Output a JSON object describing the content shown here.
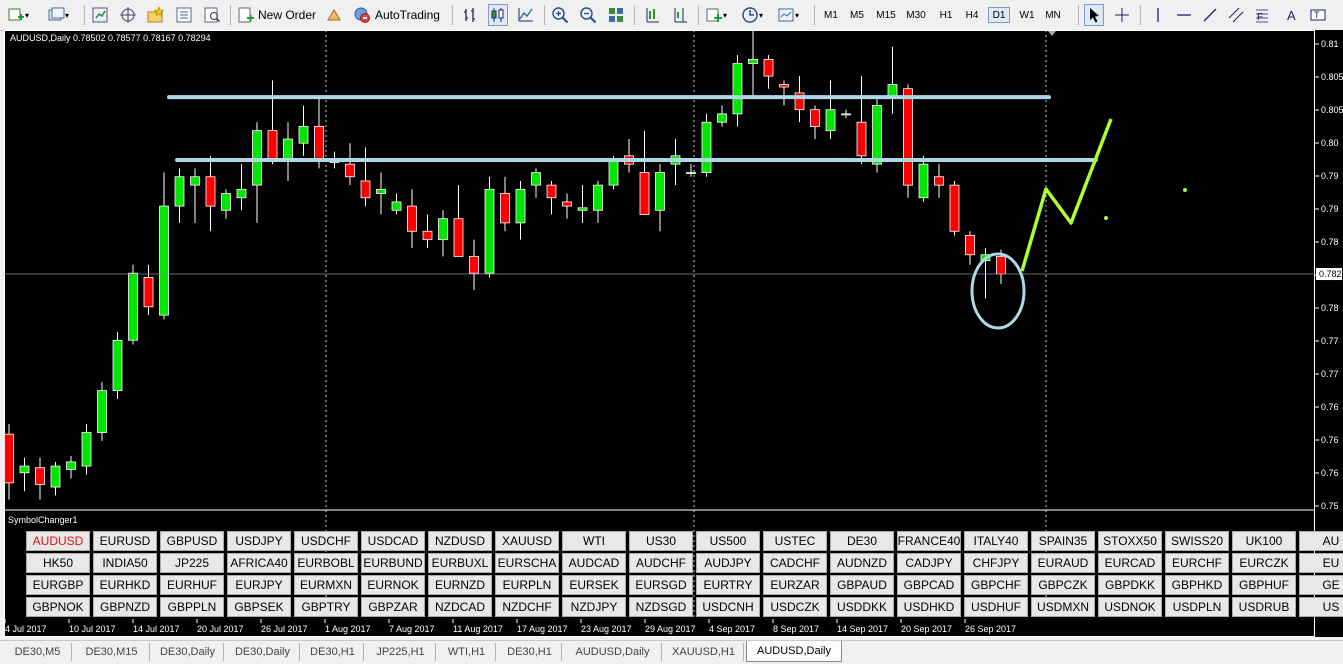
{
  "toolbar": {
    "new_order_label": "New Order",
    "autotrading_label": "AutoTrading",
    "timeframes": [
      "M1",
      "M5",
      "M15",
      "M30",
      "H1",
      "H4",
      "D1",
      "W1",
      "MN"
    ],
    "active_timeframe": "D1"
  },
  "chart": {
    "info_text": "AUDUSD,Daily  0.78502 0.78577 0.78167 0.78294",
    "symbol_changer_label": "SymbolChanger1",
    "price_axis_labels": [
      "0.81",
      "0.805",
      "0.805",
      "0.80",
      "0.79",
      "0.79",
      "0.78",
      "0.78",
      "0.78",
      "0.77",
      "0.77",
      "0.76",
      "0.76",
      "0.76",
      "0.75"
    ],
    "current_price_label": "0.782",
    "date_axis_labels": [
      "4 Jul 2017",
      "10 Jul 2017",
      "14 Jul 2017",
      "20 Jul 2017",
      "26 Jul 2017",
      "1 Aug 2017",
      "7 Aug 2017",
      "11 Aug 2017",
      "17 Aug 2017",
      "23 Aug 2017",
      "29 Aug 2017",
      "4 Sep 2017",
      "8 Sep 2017",
      "14 Sep 2017",
      "20 Sep 2017",
      "26 Sep 2017"
    ]
  },
  "chart_data": {
    "type": "candlestick",
    "symbol": "AUDUSD",
    "timeframe": "Daily",
    "ylim": [
      0.755,
      0.812
    ],
    "candles": [
      {
        "o": 0.7638,
        "h": 0.765,
        "l": 0.756,
        "c": 0.758
      },
      {
        "o": 0.7592,
        "h": 0.761,
        "l": 0.757,
        "c": 0.76
      },
      {
        "o": 0.7598,
        "h": 0.761,
        "l": 0.756,
        "c": 0.7578
      },
      {
        "o": 0.7575,
        "h": 0.7605,
        "l": 0.7565,
        "c": 0.76
      },
      {
        "o": 0.7596,
        "h": 0.7612,
        "l": 0.7585,
        "c": 0.7605
      },
      {
        "o": 0.76,
        "h": 0.765,
        "l": 0.759,
        "c": 0.764
      },
      {
        "o": 0.764,
        "h": 0.77,
        "l": 0.763,
        "c": 0.769
      },
      {
        "o": 0.769,
        "h": 0.776,
        "l": 0.768,
        "c": 0.775
      },
      {
        "o": 0.775,
        "h": 0.784,
        "l": 0.7745,
        "c": 0.783
      },
      {
        "o": 0.7825,
        "h": 0.784,
        "l": 0.778,
        "c": 0.779
      },
      {
        "o": 0.778,
        "h": 0.795,
        "l": 0.7775,
        "c": 0.791
      },
      {
        "o": 0.791,
        "h": 0.7955,
        "l": 0.789,
        "c": 0.7945
      },
      {
        "o": 0.7935,
        "h": 0.7955,
        "l": 0.789,
        "c": 0.7945
      },
      {
        "o": 0.7945,
        "h": 0.797,
        "l": 0.788,
        "c": 0.791
      },
      {
        "o": 0.7905,
        "h": 0.793,
        "l": 0.7895,
        "c": 0.7925
      },
      {
        "o": 0.792,
        "h": 0.796,
        "l": 0.7905,
        "c": 0.793
      },
      {
        "o": 0.7935,
        "h": 0.801,
        "l": 0.789,
        "c": 0.8
      },
      {
        "o": 0.8,
        "h": 0.806,
        "l": 0.796,
        "c": 0.7965
      },
      {
        "o": 0.7965,
        "h": 0.801,
        "l": 0.794,
        "c": 0.799
      },
      {
        "o": 0.7985,
        "h": 0.803,
        "l": 0.797,
        "c": 0.8005
      },
      {
        "o": 0.8005,
        "h": 0.804,
        "l": 0.7955,
        "c": 0.7965
      },
      {
        "o": 0.7962,
        "h": 0.7975,
        "l": 0.7955,
        "c": 0.7965
      },
      {
        "o": 0.796,
        "h": 0.7985,
        "l": 0.7935,
        "c": 0.7945
      },
      {
        "o": 0.794,
        "h": 0.798,
        "l": 0.791,
        "c": 0.792
      },
      {
        "o": 0.7925,
        "h": 0.795,
        "l": 0.79,
        "c": 0.793
      },
      {
        "o": 0.7905,
        "h": 0.7925,
        "l": 0.79,
        "c": 0.7915
      },
      {
        "o": 0.791,
        "h": 0.793,
        "l": 0.786,
        "c": 0.788
      },
      {
        "o": 0.788,
        "h": 0.79,
        "l": 0.786,
        "c": 0.787
      },
      {
        "o": 0.787,
        "h": 0.7905,
        "l": 0.785,
        "c": 0.7895
      },
      {
        "o": 0.7895,
        "h": 0.7935,
        "l": 0.785,
        "c": 0.785
      },
      {
        "o": 0.785,
        "h": 0.787,
        "l": 0.781,
        "c": 0.783
      },
      {
        "o": 0.783,
        "h": 0.7945,
        "l": 0.7825,
        "c": 0.793
      },
      {
        "o": 0.7925,
        "h": 0.7945,
        "l": 0.788,
        "c": 0.789
      },
      {
        "o": 0.789,
        "h": 0.794,
        "l": 0.787,
        "c": 0.793
      },
      {
        "o": 0.7935,
        "h": 0.7955,
        "l": 0.792,
        "c": 0.795
      },
      {
        "o": 0.7935,
        "h": 0.794,
        "l": 0.79,
        "c": 0.792
      },
      {
        "o": 0.7915,
        "h": 0.7925,
        "l": 0.7895,
        "c": 0.791
      },
      {
        "o": 0.7905,
        "h": 0.7935,
        "l": 0.789,
        "c": 0.7908
      },
      {
        "o": 0.7905,
        "h": 0.794,
        "l": 0.789,
        "c": 0.7935
      },
      {
        "o": 0.7935,
        "h": 0.797,
        "l": 0.793,
        "c": 0.7965
      },
      {
        "o": 0.797,
        "h": 0.799,
        "l": 0.795,
        "c": 0.796
      },
      {
        "o": 0.795,
        "h": 0.8,
        "l": 0.79,
        "c": 0.79
      },
      {
        "o": 0.7905,
        "h": 0.796,
        "l": 0.788,
        "c": 0.795
      },
      {
        "o": 0.796,
        "h": 0.799,
        "l": 0.7935,
        "c": 0.797
      },
      {
        "o": 0.795,
        "h": 0.796,
        "l": 0.7945,
        "c": 0.795
      },
      {
        "o": 0.795,
        "h": 0.802,
        "l": 0.7945,
        "c": 0.801
      },
      {
        "o": 0.801,
        "h": 0.803,
        "l": 0.8005,
        "c": 0.802
      },
      {
        "o": 0.802,
        "h": 0.809,
        "l": 0.8005,
        "c": 0.808
      },
      {
        "o": 0.808,
        "h": 0.812,
        "l": 0.804,
        "c": 0.8085
      },
      {
        "o": 0.8085,
        "h": 0.809,
        "l": 0.805,
        "c": 0.8065
      },
      {
        "o": 0.8055,
        "h": 0.806,
        "l": 0.803,
        "c": 0.8052
      },
      {
        "o": 0.8045,
        "h": 0.8065,
        "l": 0.801,
        "c": 0.8025
      },
      {
        "o": 0.8025,
        "h": 0.803,
        "l": 0.799,
        "c": 0.8005
      },
      {
        "o": 0.8,
        "h": 0.806,
        "l": 0.799,
        "c": 0.8025
      },
      {
        "o": 0.802,
        "h": 0.8025,
        "l": 0.8015,
        "c": 0.802
      },
      {
        "o": 0.801,
        "h": 0.8065,
        "l": 0.796,
        "c": 0.797
      },
      {
        "o": 0.796,
        "h": 0.804,
        "l": 0.795,
        "c": 0.803
      },
      {
        "o": 0.804,
        "h": 0.81,
        "l": 0.802,
        "c": 0.8055
      },
      {
        "o": 0.805,
        "h": 0.8055,
        "l": 0.792,
        "c": 0.7935
      },
      {
        "o": 0.792,
        "h": 0.797,
        "l": 0.7915,
        "c": 0.796
      },
      {
        "o": 0.7945,
        "h": 0.796,
        "l": 0.792,
        "c": 0.7935
      },
      {
        "o": 0.7935,
        "h": 0.794,
        "l": 0.7875,
        "c": 0.788
      },
      {
        "o": 0.7875,
        "h": 0.788,
        "l": 0.784,
        "c": 0.7852
      },
      {
        "o": 0.7845,
        "h": 0.786,
        "l": 0.78,
        "c": 0.7852
      },
      {
        "o": 0.785,
        "h": 0.7858,
        "l": 0.7817,
        "c": 0.7829
      }
    ],
    "horizontal_lines": [
      0.804,
      0.7965
    ],
    "current_price": 0.7829
  },
  "symbol_changer": {
    "active": "AUDUSD",
    "rows": [
      [
        "AUDUSD",
        "EURUSD",
        "GBPUSD",
        "USDJPY",
        "USDCHF",
        "USDCAD",
        "NZDUSD",
        "XAUUSD",
        "WTI",
        "US30",
        "US500",
        "USTEC",
        "DE30",
        "FRANCE40",
        "ITALY40",
        "SPAIN35",
        "STOXX50",
        "SWISS20",
        "UK100",
        "AU"
      ],
      [
        "HK50",
        "INDIA50",
        "JP225",
        "AFRICA40",
        "EURBOBL",
        "EURBUND",
        "EURBUXL",
        "EURSCHA",
        "AUDCAD",
        "AUDCHF",
        "AUDJPY",
        "CADCHF",
        "AUDNZD",
        "CADJPY",
        "CHFJPY",
        "EURAUD",
        "EURCAD",
        "EURCHF",
        "EURCZK",
        "EU"
      ],
      [
        "EURGBP",
        "EURHKD",
        "EURHUF",
        "EURJPY",
        "EURMXN",
        "EURNOK",
        "EURNZD",
        "EURPLN",
        "EURSEK",
        "EURSGD",
        "EURTRY",
        "EURZAR",
        "GBPAUD",
        "GBPCAD",
        "GBPCHF",
        "GBPCZK",
        "GBPDKK",
        "GBPHKD",
        "GBPHUF",
        "GE"
      ],
      [
        "GBPNOK",
        "GBPNZD",
        "GBPPLN",
        "GBPSEK",
        "GBPTRY",
        "GBPZAR",
        "NZDCAD",
        "NZDCHF",
        "NZDJPY",
        "NZDSGD",
        "USDCNH",
        "USDCZK",
        "USDDKK",
        "USDHKD",
        "USDHUF",
        "USDMXN",
        "USDNOK",
        "USDPLN",
        "USDRUB",
        "US"
      ]
    ]
  },
  "tabs": {
    "items": [
      "DE30,M5",
      "DE30,M15",
      "DE30,Daily",
      "DE30,Daily",
      "DE30,H1",
      "JP225,H1",
      "WTI,H1",
      "DE30,H1",
      "AUDUSD,Daily",
      "XAUUSD,H1",
      "AUDUSD,Daily"
    ],
    "active_index": 10
  },
  "colors": {
    "bull": "#00e600",
    "bear": "#ff0000",
    "hline": "#add8e6",
    "annotation": "#adff2f",
    "circle": "#add8e6",
    "background": "#000000",
    "grid_dotted": "#ffffff"
  }
}
